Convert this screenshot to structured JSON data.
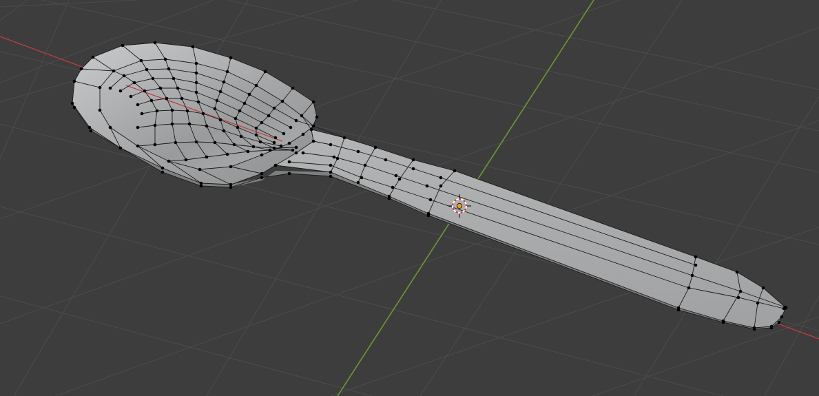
{
  "viewport": {
    "mode": "edit-mode-3d-viewport",
    "background": "#3d3d3d",
    "grid_color": "#4c4c4c",
    "x_axis_color": "#c23b3b",
    "y_axis_color": "#6b9a2e",
    "mesh_color": "#a6a7a8",
    "vertex_color": "#000000"
  },
  "object": {
    "kind": "spoon-mesh",
    "origin_marker": "3d-cursor-icon"
  }
}
